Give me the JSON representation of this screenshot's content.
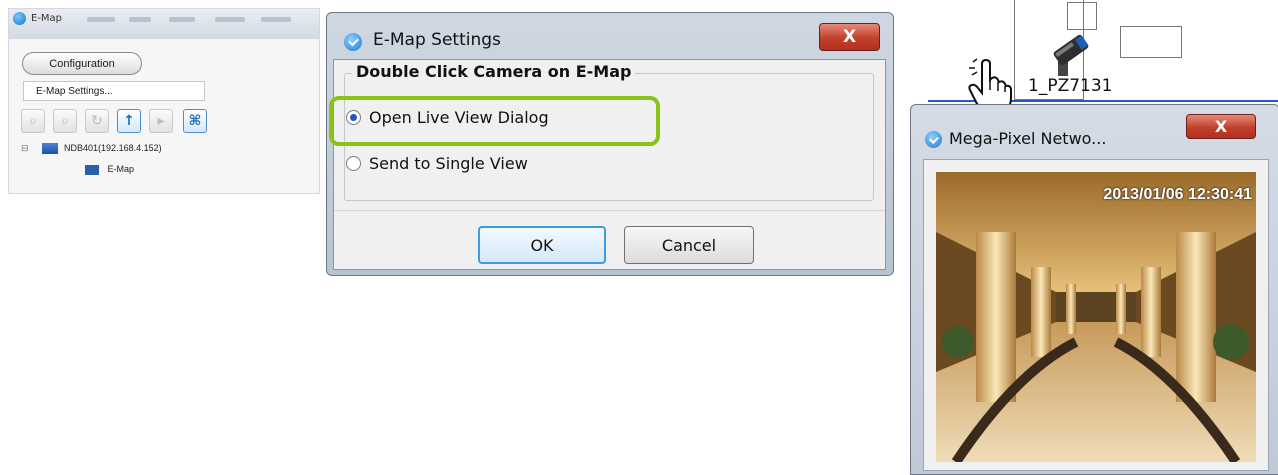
{
  "emap_panel": {
    "window_title": "E-Map",
    "configuration_button": "Configuration",
    "settings_menu_item": "E-Map Settings...",
    "toolbar_icons": [
      "zoom-in-icon",
      "zoom-out-icon",
      "refresh-icon",
      "upload-icon",
      "play-icon",
      "fit-screen-icon"
    ],
    "tree_root": "NDB401(192.168.4.152)",
    "tree_child": "E-Map"
  },
  "settings_dialog": {
    "title": "E-Map Settings",
    "close_label": "X",
    "group_label": "Double Click Camera on E-Map",
    "options": [
      {
        "label": "Open Live View Dialog",
        "selected": true
      },
      {
        "label": "Send to Single View",
        "selected": false
      }
    ],
    "ok_label": "OK",
    "cancel_label": "Cancel",
    "highlight_color": "#8ac219"
  },
  "map_view": {
    "camera_label": "1_PZ7131",
    "line_color": "#2b55c4"
  },
  "live_view": {
    "title": "Mega-Pixel Netwo...",
    "close_label": "X",
    "timestamp": "2013/01/06 12:30:41"
  },
  "colors": {
    "accent_blue": "#1d7bd0",
    "close_red": "#c2402b"
  }
}
